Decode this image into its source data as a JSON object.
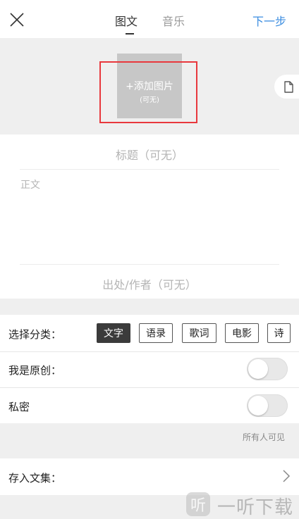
{
  "header": {
    "tabs": [
      {
        "label": "图文",
        "active": true
      },
      {
        "label": "音乐",
        "active": false
      }
    ],
    "next_label": "下一步"
  },
  "image_picker": {
    "label": "+添加图片",
    "sublabel": "(可无)"
  },
  "editor": {
    "title_placeholder": "标题（可无）",
    "body_placeholder": "正文",
    "source_placeholder": "出处/作者（可无）"
  },
  "category": {
    "label": "选择分类：",
    "options": [
      "文字",
      "语录",
      "歌词",
      "电影",
      "诗"
    ],
    "selected": "文字"
  },
  "original": {
    "label": "我是原创：",
    "enabled": false
  },
  "private": {
    "label": "私密",
    "enabled": false,
    "note": "所有人可见"
  },
  "collection": {
    "label": "存入文集："
  },
  "watermark": {
    "text": "一听下载"
  },
  "colors": {
    "accent": "#3b8de0",
    "highlight": "#e8383d",
    "chip_active": "#3b3b3b"
  }
}
